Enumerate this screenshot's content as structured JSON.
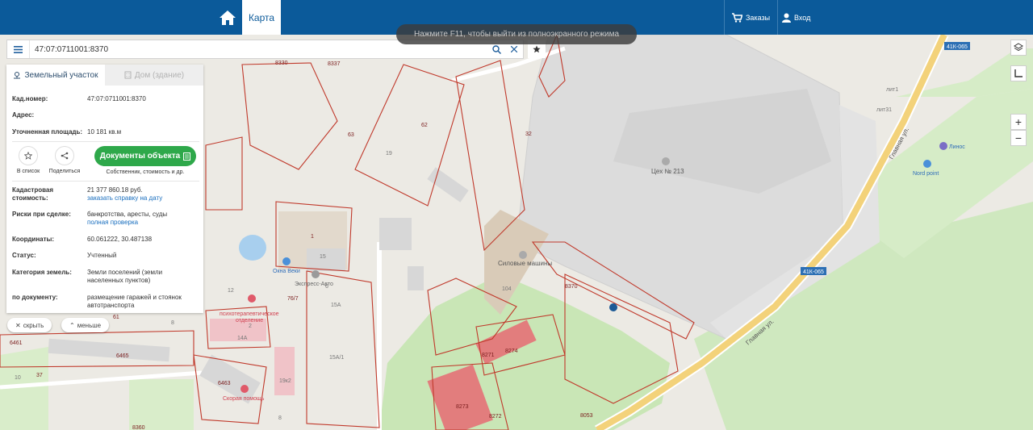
{
  "header": {
    "map_tab": "Карта",
    "orders_label": "Заказы",
    "login_label": "Вход"
  },
  "toast": "Нажмите F11, чтобы выйти из полноэкранного режима",
  "search": {
    "value": "47:07:0711001:8370"
  },
  "panel": {
    "tab_land": "Земельный участок",
    "tab_house": "Дом (здание)",
    "cad_number_label": "Кад.номер:",
    "cad_number_value": "47:07:0711001:8370",
    "address_label": "Адрес:",
    "area_label": "Уточненная площадь:",
    "area_value": "10 181 кв.м",
    "add_to_list": "В список",
    "share": "Поделиться",
    "docs_button": "Документы объекта",
    "docs_sub": "Собственник, стоимость и др.",
    "cost_label_1": "Кадастровая",
    "cost_label_2": "стоимость:",
    "cost_value": "21 377 860.18 руб.",
    "cost_link": "заказать справку на дату",
    "risks_label": "Риски при сделке:",
    "risks_value": "банкротства, аресты, суды",
    "risks_link": "полная проверка",
    "coords_label": "Координаты:",
    "coords_value": "60.061222, 30.487138",
    "status_label": "Статус:",
    "status_value": "Учтенный",
    "category_label": "Категория земель:",
    "category_value_1": "Земли поселений (земли",
    "category_value_2": "населенных пунктов)",
    "doc_label": "по документу:",
    "doc_value_1": "размещение гаражей и стоянок",
    "doc_value_2": "автотранспорта"
  },
  "pills": {
    "hide": "скрыть",
    "less": "меньше"
  },
  "controls": {
    "zoom_in": "+",
    "zoom_out": "−"
  },
  "map_labels": {
    "l8330": "8330",
    "l8337": "8337",
    "l63": "63",
    "l62": "62",
    "l32": "32",
    "l19": "19",
    "l1": "1",
    "l15": "15",
    "l104": "104",
    "l8370": "8370",
    "l12": "12",
    "l7": "7",
    "l76": "76/7",
    "l6": "6",
    "l15a": "15А",
    "l14a": "14А",
    "l2": "2",
    "l8": "8",
    "l6465": "6465",
    "l6461": "6461",
    "l61": "61",
    "l6463": "6463",
    "l10": "10",
    "l37": "37",
    "l19k2": "19к2",
    "l15a1": "15А/1",
    "l8271": "8271",
    "l8274": "8274",
    "l8273": "8273",
    "l8272": "8272",
    "l8053": "8053",
    "l8360": "8360",
    "l8b": "8",
    "road1": "41К-065",
    "road2": "41К-065",
    "street1": "Главная ул.",
    "street2": "Главная ул.",
    "ceh": "Цех № 213",
    "silovye": "Силовые машины",
    "okna": "Окна Веки",
    "express": "Экспресс-Авто",
    "psych1": "психотерапевтическое",
    "psych2": "отделение",
    "ambulance": "Скорая помощь",
    "linos": "Линос",
    "nordpoint": "Nord point",
    "lit1": "лит1",
    "lit31": "лит31"
  },
  "colors": {
    "header": "#0b5a9a",
    "accent_green": "#2ea84a",
    "parcel_outline": "#c0392b",
    "link": "#1a6fbf"
  }
}
